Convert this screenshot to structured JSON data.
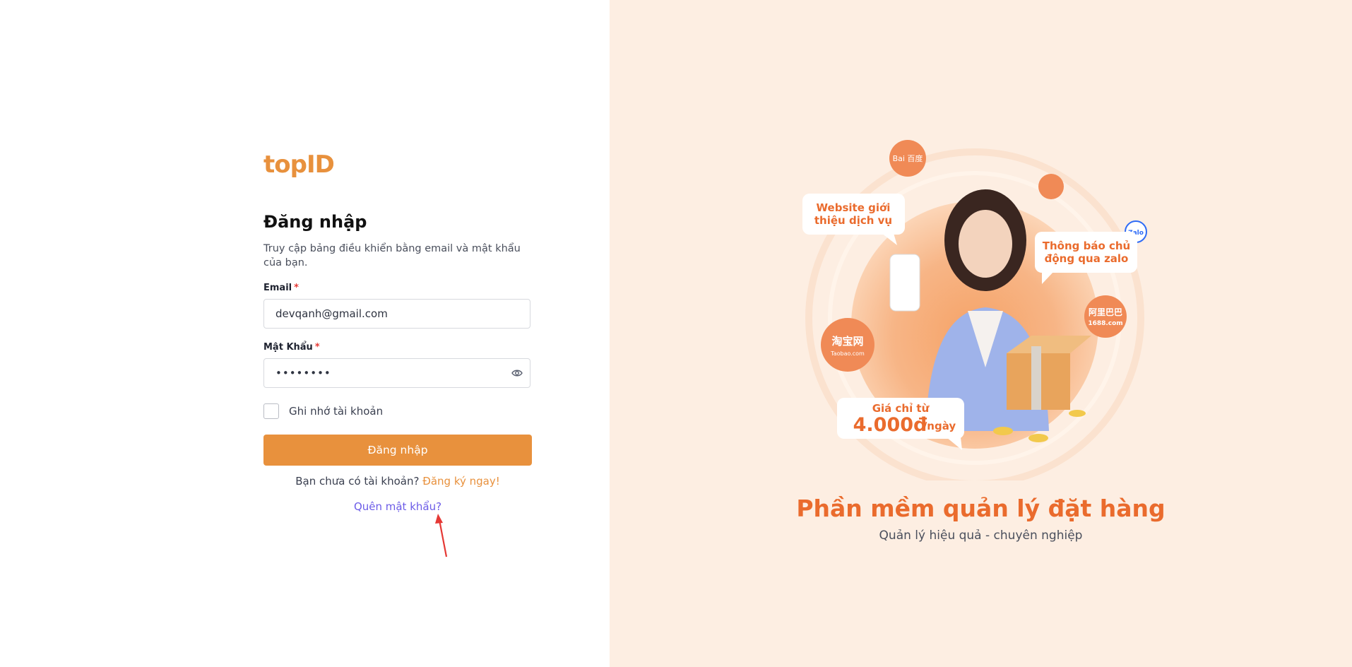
{
  "brand": {
    "logo_text": "topID",
    "color": "#E8913D"
  },
  "login": {
    "title": "Đăng nhập",
    "subtitle": "Truy cập bảng điều khiển bằng email và mật khẩu của bạn.",
    "email_label": "Email",
    "email_value": "devqanh@gmail.com",
    "password_label": "Mật Khẩu",
    "password_value": "••••••••",
    "required_mark": "*",
    "remember_label": "Ghi nhớ tài khoản",
    "submit_label": "Đăng nhập",
    "no_account_text": "Bạn chưa có tài khoản?",
    "signup_link": "Đăng ký ngay!",
    "forgot_link": "Quên mật khẩu?"
  },
  "promo": {
    "title": "Phần mềm quản lý đặt hàng",
    "subtitle": "Quản lý hiệu quả - chuyên nghiệp",
    "bubble_website_line1": "Website giới",
    "bubble_website_line2": "thiệu dịch vụ",
    "bubble_zalo_line1": "Thông báo chủ",
    "bubble_zalo_line2": "động qua zalo",
    "price_label": "Giá chỉ từ",
    "price_value": "4.000đ",
    "price_unit": "/ngày",
    "badge_baidu": "Bai 百度",
    "badge_taobao": "淘宝网",
    "badge_taobao_sub": "Taobao.com",
    "badge_1688": "阿里巴巴",
    "badge_1688_sub": "1688.com",
    "badge_zalo": "Zalo"
  },
  "colors": {
    "accent": "#E8913D",
    "link_purple": "#6C5CE7",
    "promo_bg": "#FDEEE2",
    "promo_title": "#EA6B2D",
    "annotation_arrow": "#E53935"
  }
}
